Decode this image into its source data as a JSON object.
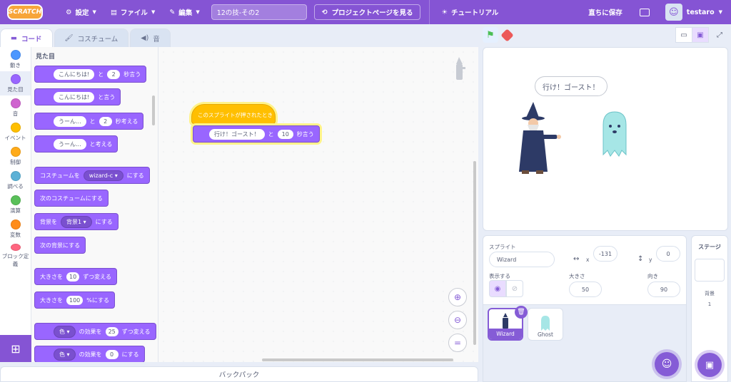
{
  "menubar": {
    "logo": "SCRATCH",
    "settings": "設定",
    "file": "ファイル",
    "edit": "編集",
    "project_title": "12の技-その2",
    "project_page": "プロジェクトページを見る",
    "tutorial": "チュートリアル",
    "save_now": "直ちに保存",
    "username": "testaro"
  },
  "tabs": {
    "code": "コード",
    "costumes": "コスチューム",
    "sounds": "音"
  },
  "categories": [
    {
      "label": "動き",
      "color": "#4c97ff"
    },
    {
      "label": "見た目",
      "color": "#9966ff"
    },
    {
      "label": "音",
      "color": "#cf63cf"
    },
    {
      "label": "イベント",
      "color": "#ffbf00"
    },
    {
      "label": "制御",
      "color": "#ffab19"
    },
    {
      "label": "調べる",
      "color": "#5cb1d6"
    },
    {
      "label": "演算",
      "color": "#59c059"
    },
    {
      "label": "変数",
      "color": "#ff8c1a"
    },
    {
      "label": "ブロック定義",
      "color": "#ff6680"
    }
  ],
  "palette": {
    "heading": "見た目",
    "b1": {
      "text": "こんにちは!",
      "t1": "と",
      "n": "2",
      "t2": "秒言う"
    },
    "b2": {
      "text": "こんにちは!",
      "t1": "と言う"
    },
    "b3": {
      "text": "うーん...",
      "t1": "と",
      "n": "2",
      "t2": "秒考える"
    },
    "b4": {
      "text": "うーん...",
      "t1": "と考える"
    },
    "b5": {
      "t0": "コスチュームを",
      "drop": "wizard-c",
      "t1": "にする"
    },
    "b6": {
      "t0": "次のコスチュームにする"
    },
    "b7": {
      "t0": "背景を",
      "drop": "背景1",
      "t1": "にする"
    },
    "b8": {
      "t0": "次の背景にする"
    },
    "b9": {
      "t0": "大きさを",
      "n": "10",
      "t1": "ずつ変える"
    },
    "b10": {
      "t0": "大きさを",
      "n": "100",
      "t1": "%にする"
    },
    "b11": {
      "drop": "色",
      "t1": "の効果を",
      "n": "25",
      "t2": "ずつ変える"
    },
    "b12": {
      "drop": "色",
      "t1": "の効果を",
      "n": "0",
      "t2": "にする"
    }
  },
  "script": {
    "hat": "このスプライトが押されたとき",
    "say_text": "行け！ゴースト！",
    "say_t1": "と",
    "say_n": "10",
    "say_t2": "秒言う"
  },
  "backpack": "バックパック",
  "stage": {
    "bubble": "行け！ゴースト！"
  },
  "sprite_info": {
    "sprite_label": "スプライト",
    "sprite_name": "Wizard",
    "x_label": "x",
    "x_value": "-131",
    "y_label": "y",
    "y_value": "0",
    "show_label": "表示する",
    "size_label": "大きさ",
    "size_value": "50",
    "direction_label": "向き",
    "direction_value": "90"
  },
  "sprites": [
    {
      "name": "Wizard",
      "selected": true
    },
    {
      "name": "Ghost",
      "selected": false
    }
  ],
  "stage_pane": {
    "head": "ステージ",
    "backdrop_label": "背景",
    "backdrop_count": "1"
  },
  "colors": {
    "accent": "#855cd6",
    "looks": "#9966ff",
    "events": "#ffbf00"
  }
}
